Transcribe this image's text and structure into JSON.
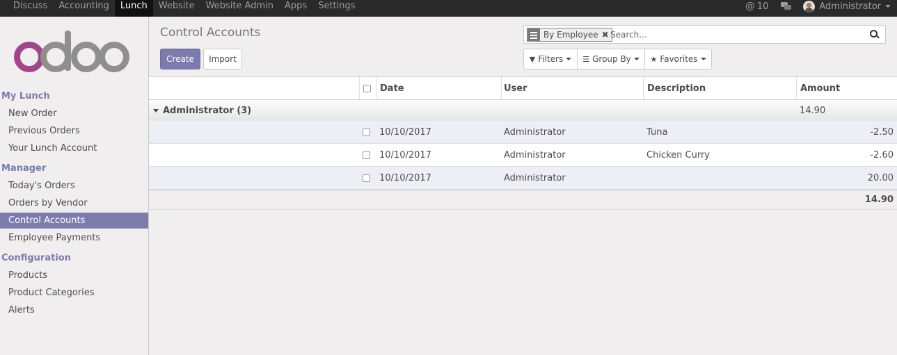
{
  "topbar": {
    "menus": [
      "Discuss",
      "Accounting",
      "Lunch",
      "Website",
      "Website Admin",
      "Apps",
      "Settings"
    ],
    "active_menu": "Lunch",
    "mention_count": "10",
    "user_name": "Administrator"
  },
  "brand_colors": {
    "primary": "#7c7bad",
    "logo_accent": "#a24689",
    "navbar": "#2a2a2a"
  },
  "sidebar": {
    "sections": [
      {
        "title": "My Lunch",
        "items": [
          "New Order",
          "Previous Orders",
          "Your Lunch Account"
        ]
      },
      {
        "title": "Manager",
        "items": [
          "Today's Orders",
          "Orders by Vendor",
          "Control Accounts",
          "Employee Payments"
        ]
      },
      {
        "title": "Configuration",
        "items": [
          "Products",
          "Product Categories",
          "Alerts"
        ]
      }
    ],
    "active_item": "Control Accounts"
  },
  "control_panel": {
    "title": "Control Accounts",
    "create_label": "Create",
    "import_label": "Import",
    "search": {
      "facet_label": "By Employee",
      "facet_icon": "list-icon",
      "placeholder": "Search..."
    },
    "filters_label": "Filters",
    "groupby_label": "Group By",
    "favorites_label": "Favorites"
  },
  "table": {
    "columns": [
      "Date",
      "User",
      "Description",
      "Amount"
    ],
    "group": {
      "label": "Administrator (3)",
      "total": "14.90"
    },
    "rows": [
      {
        "date": "10/10/2017",
        "user": "Administrator",
        "description": "Tuna",
        "amount": "-2.50"
      },
      {
        "date": "10/10/2017",
        "user": "Administrator",
        "description": "Chicken Curry",
        "amount": "-2.60"
      },
      {
        "date": "10/10/2017",
        "user": "Administrator",
        "description": "",
        "amount": "20.00"
      }
    ],
    "footer_total": "14.90"
  }
}
